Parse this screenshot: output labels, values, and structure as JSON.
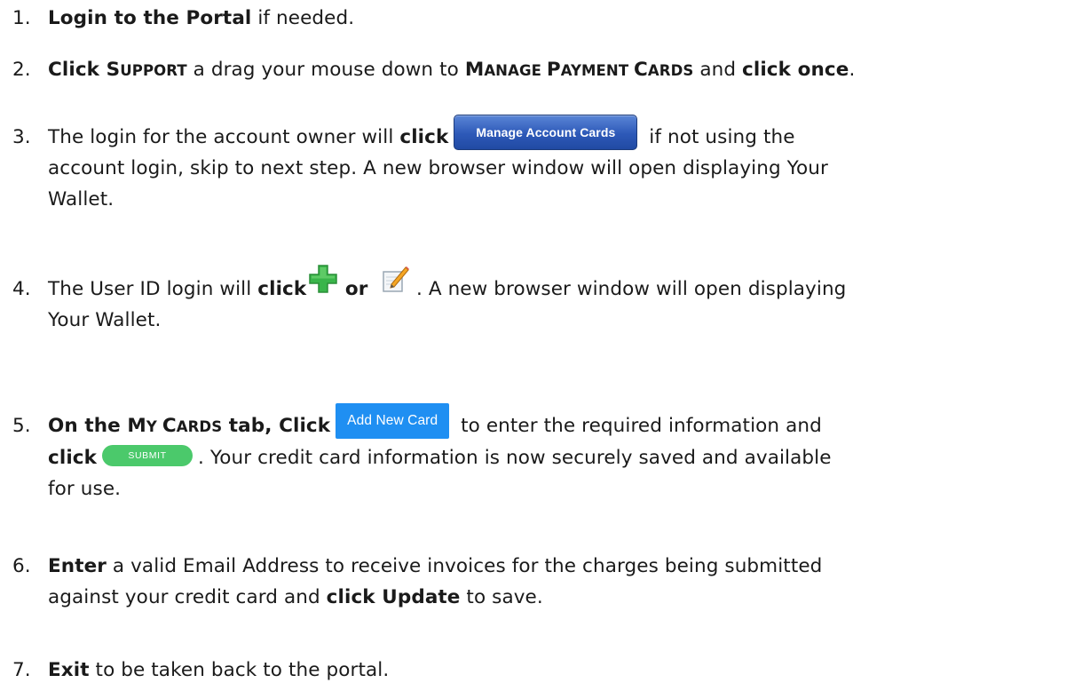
{
  "steps": [
    {
      "number": "1.",
      "bold_1": "Login to the Portal",
      "text_1": " if needed."
    },
    {
      "number": "2.",
      "bold_1": "Click ",
      "support_S": "S",
      "support_rest": "UPPORT",
      "text_1": " a drag your mouse down to ",
      "manage_M": "M",
      "manage_rest": "ANAGE ",
      "payment_P": "P",
      "payment_rest": "AYMENT ",
      "cards_C": "C",
      "cards_rest": "ARDS",
      "text_2": " and ",
      "bold_2": "click once",
      "text_3": "."
    },
    {
      "number": "3.",
      "text_1": "The login for the account owner will ",
      "bold_1": "click",
      "button_label": "Manage Account Cards",
      "text_2": " if not using the",
      "line_2": "account login, skip to next step. A new browser window will open displaying Your",
      "line_3": "Wallet."
    },
    {
      "number": "4.",
      "text_1": "The User ID login will ",
      "bold_1": "click",
      "bold_2": " or ",
      "text_2": " . A new browser window will open displaying",
      "line_2": "Your Wallet.",
      "plus_icon_color": "#39b54a",
      "edit_icon_color": "#f5a623"
    },
    {
      "number": "5.",
      "bold_1": "On the ",
      "my_M": "M",
      "my_rest": "Y ",
      "cards_C": "C",
      "cards_rest": "ARDS",
      "bold_2": " tab, Click",
      "add_button_label": "Add New Card",
      "text_1": " to enter the required information and",
      "bold_3": "click",
      "submit_button_label": "SUBMIT",
      "text_2": ". Your credit card information is now securely saved and available",
      "line_3": "for use."
    },
    {
      "number": "6.",
      "bold_1": "Enter",
      "text_1": " a valid Email Address to receive invoices for the charges being submitted",
      "line_2_text_1": "against your credit card and ",
      "line_2_bold": "click Update",
      "line_2_text_2": " to save."
    },
    {
      "number": "7.",
      "bold_1": "Exit",
      "text_1": " to be taken back to the portal."
    }
  ],
  "colors": {
    "manage_button": "#2d59b8",
    "add_button": "#1f8ff2",
    "submit_button": "#4bc96b"
  }
}
